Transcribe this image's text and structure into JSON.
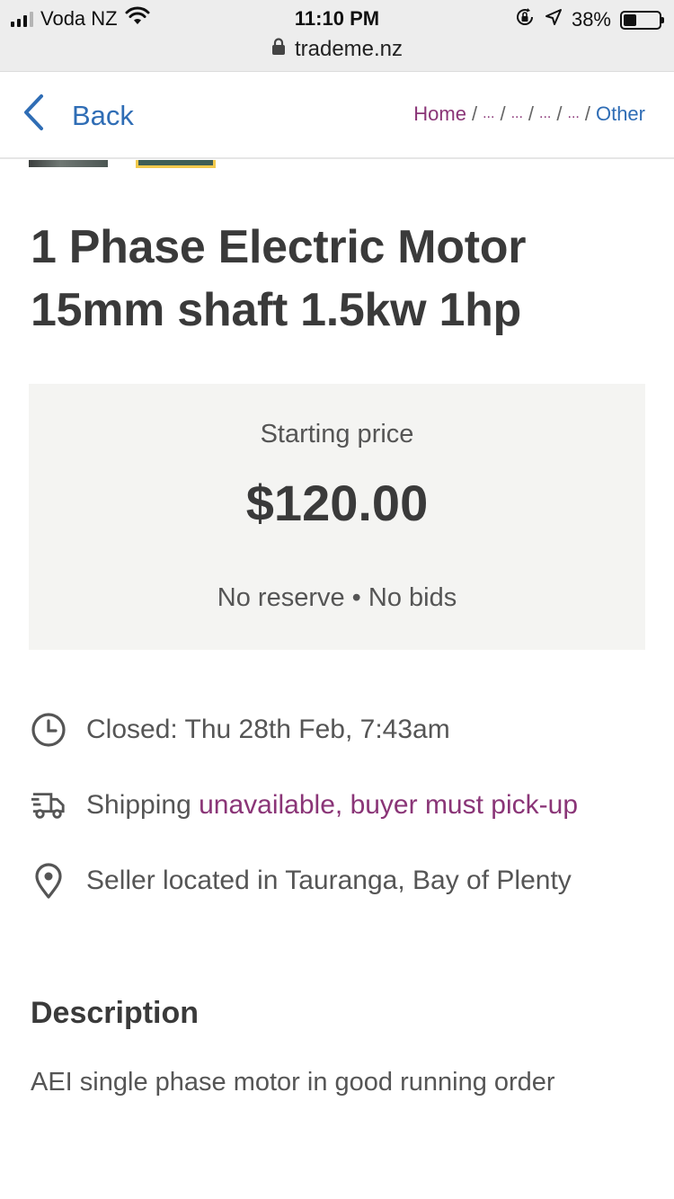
{
  "status": {
    "carrier": "Voda NZ",
    "time": "11:10 PM",
    "battery": "38%",
    "battery_level": 0.38
  },
  "browser": {
    "url": "trademe.nz"
  },
  "nav": {
    "back_label": "Back",
    "breadcrumb": {
      "home": "Home",
      "sep": "/",
      "ellipsis": "...",
      "last": "Other"
    }
  },
  "listing": {
    "title": "1 Phase Electric Motor 15mm shaft 1.5kw 1hp",
    "price_label": "Starting price",
    "price": "$120.00",
    "price_meta": "No reserve • No bids",
    "closed": "Closed: Thu 28th Feb, 7:43am",
    "shipping_prefix": "Shipping",
    "shipping_link": "unavailable, buyer must pick-up",
    "location": "Seller located in Tauranga, Bay of Plenty",
    "description_heading": "Description",
    "description": "AEI single phase motor in good running order"
  },
  "colors": {
    "link_blue": "#2f6db5",
    "accent_purple": "#8a3577",
    "price_bg": "#f4f4f2"
  }
}
